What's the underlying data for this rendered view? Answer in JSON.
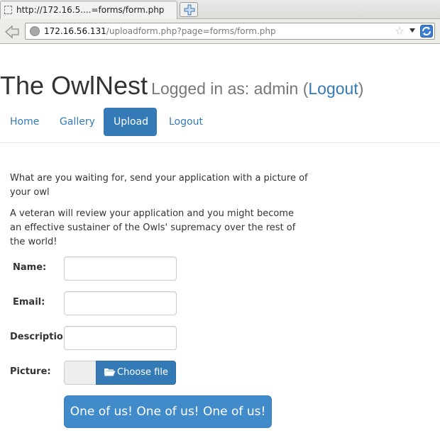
{
  "browser": {
    "tab_title": "http://172.16.5....=forms/form.php",
    "url_host": "172.16.56.131",
    "url_path": "/uploadform.php?page=forms/form.php"
  },
  "header": {
    "site_name": "The OwlNest",
    "login_prefix": "Logged in as: admin (",
    "logout_label": "Logout",
    "login_suffix": ")"
  },
  "nav": {
    "items": [
      {
        "label": "Home"
      },
      {
        "label": "Gallery"
      },
      {
        "label": "Upload"
      },
      {
        "label": "Logout"
      }
    ],
    "active": "Upload"
  },
  "intro": {
    "line1": "What are you waiting for, send your application with a picture of your owl",
    "line2": "A veteran will review your application and you might become an effective sustainer of the Owls' supremacy over the rest of the world!"
  },
  "form": {
    "name_label": "Name:",
    "name_value": "",
    "email_label": "Email:",
    "email_value": "",
    "description_label": "Description:",
    "description_value": "",
    "picture_label": "Picture:",
    "choose_file_label": "Choose file",
    "submit_label": "One of us! One of us! One of us!"
  },
  "colors": {
    "accent": "#337ab7",
    "submit": "#428bca"
  }
}
